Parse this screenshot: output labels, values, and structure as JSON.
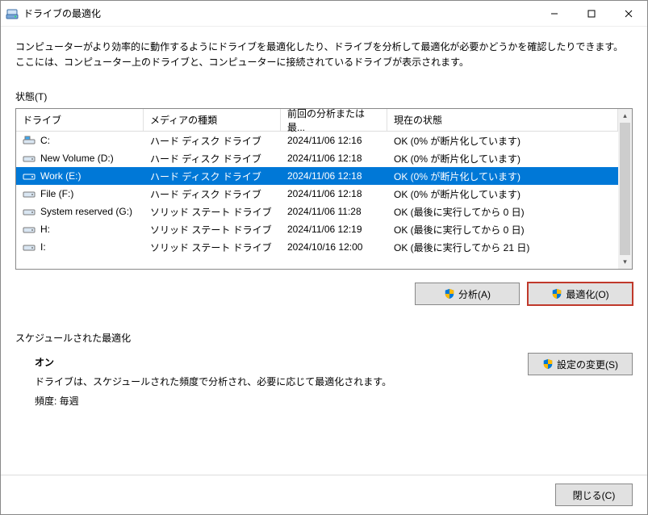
{
  "window": {
    "title": "ドライブの最適化"
  },
  "intro": {
    "line1": "コンピューターがより効率的に動作するようにドライブを最適化したり、ドライブを分析して最適化が必要かどうかを確認したりできます。",
    "line2": "ここには、コンピューター上のドライブと、コンピューターに接続されているドライブが表示されます。"
  },
  "status_section_label": "状態(T)",
  "columns": {
    "drive": "ドライブ",
    "media": "メディアの種類",
    "last": "前回の分析または最...",
    "status": "現在の状態"
  },
  "drives": [
    {
      "name": "C:",
      "media": "ハード ディスク ドライブ",
      "last": "2024/11/06 12:16",
      "status": "OK (0% が断片化しています)",
      "selected": false,
      "icon": "os"
    },
    {
      "name": "New Volume (D:)",
      "media": "ハード ディスク ドライブ",
      "last": "2024/11/06 12:18",
      "status": "OK (0% が断片化しています)",
      "selected": false,
      "icon": "hdd"
    },
    {
      "name": "Work (E:)",
      "media": "ハード ディスク ドライブ",
      "last": "2024/11/06 12:18",
      "status": "OK (0% が断片化しています)",
      "selected": true,
      "icon": "hdd"
    },
    {
      "name": "File (F:)",
      "media": "ハード ディスク ドライブ",
      "last": "2024/11/06 12:18",
      "status": "OK (0% が断片化しています)",
      "selected": false,
      "icon": "hdd"
    },
    {
      "name": "System reserved (G:)",
      "media": "ソリッド ステート ドライブ",
      "last": "2024/11/06 11:28",
      "status": "OK (最後に実行してから 0 日)",
      "selected": false,
      "icon": "hdd"
    },
    {
      "name": "H:",
      "media": "ソリッド ステート ドライブ",
      "last": "2024/11/06 12:19",
      "status": "OK (最後に実行してから 0 日)",
      "selected": false,
      "icon": "hdd"
    },
    {
      "name": "I:",
      "media": "ソリッド ステート ドライブ",
      "last": "2024/10/16 12:00",
      "status": "OK (最後に実行してから 21 日)",
      "selected": false,
      "icon": "hdd"
    }
  ],
  "buttons": {
    "analyze": "分析(A)",
    "optimize": "最適化(O)",
    "change_settings": "設定の変更(S)",
    "close": "閉じる(C)"
  },
  "schedule": {
    "section_label": "スケジュールされた最適化",
    "on_label": "オン",
    "desc": "ドライブは、スケジュールされた頻度で分析され、必要に応じて最適化されます。",
    "freq_label": "頻度: 毎週"
  }
}
